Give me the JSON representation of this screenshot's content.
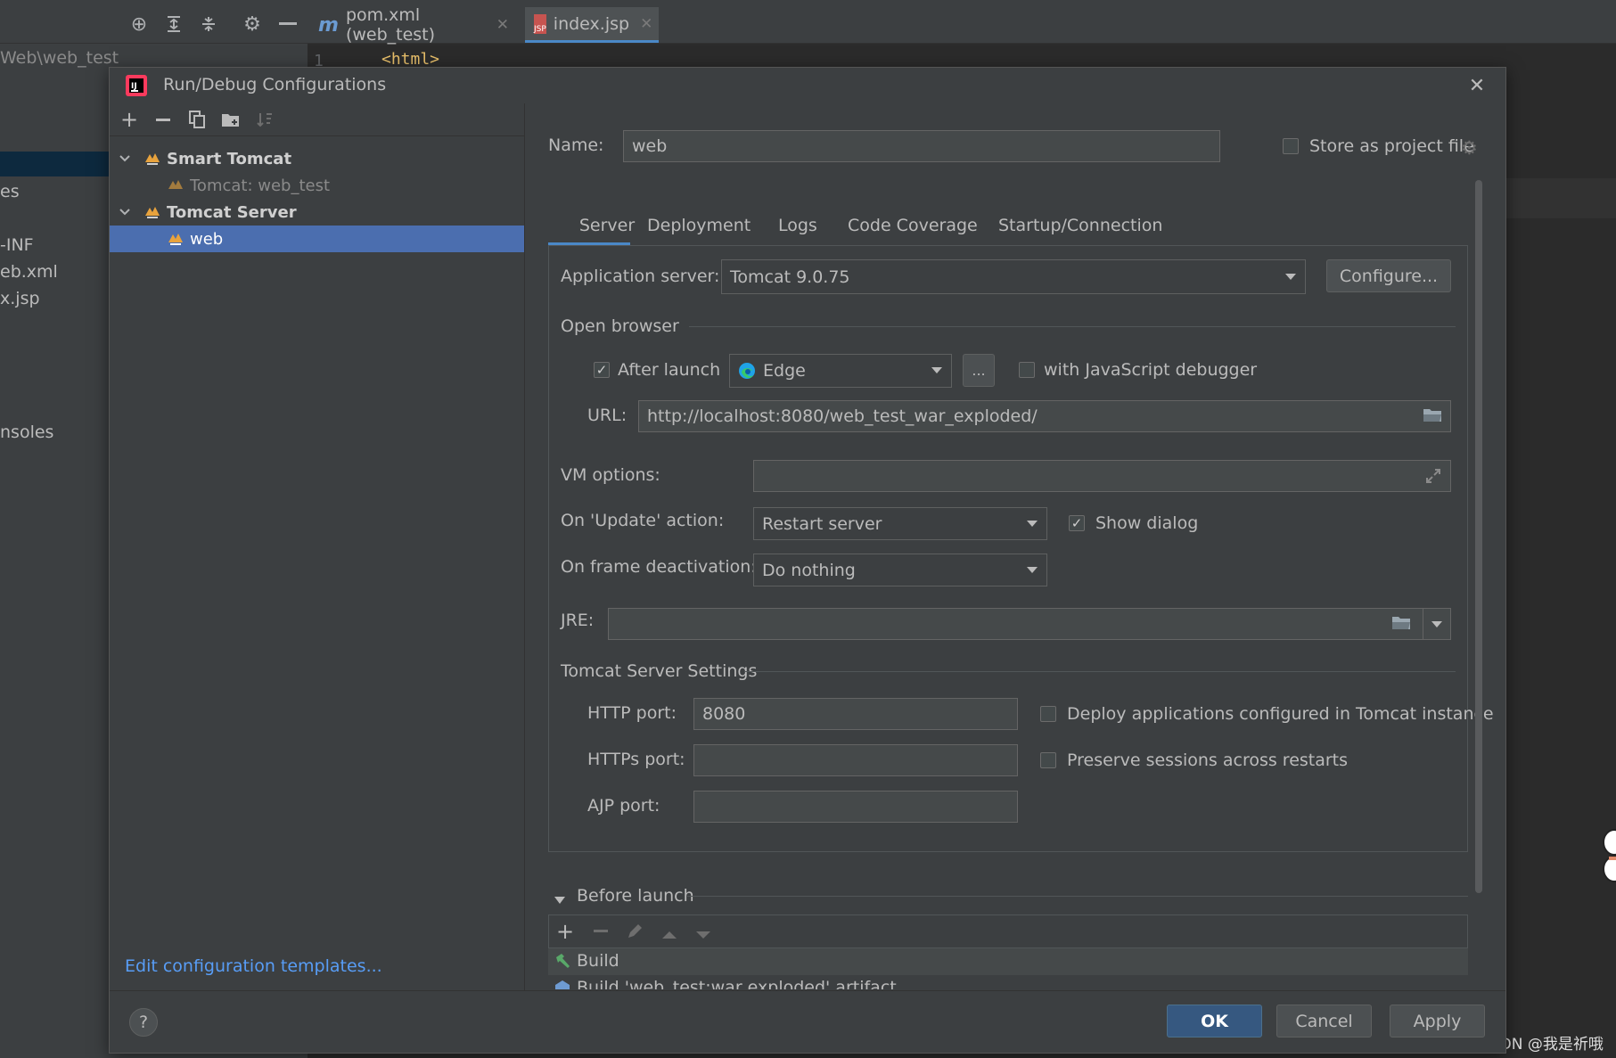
{
  "ide": {
    "tabs": [
      {
        "label": "pom.xml (web_test)",
        "icon": "maven-m-icon"
      },
      {
        "label": "index.jsp",
        "icon": "jsp-file-icon",
        "badge": "JSP"
      }
    ],
    "toolbar_icons": [
      "crosshair-icon",
      "expand-all-icon",
      "collapse-all-icon",
      "gear-icon",
      "minimize-icon"
    ],
    "project_path": "Web\\web_test",
    "tree_fragments": [
      "es",
      "-INF",
      "eb.xml",
      "x.jsp",
      "nsoles"
    ],
    "editor_line_number": "1",
    "editor_line_text": "<html>"
  },
  "dialog": {
    "title": "Run/Debug Configurations",
    "toolbar_icons": [
      "add-icon",
      "remove-icon",
      "copy-icon",
      "new-folder-icon",
      "sort-icon"
    ],
    "tree": [
      {
        "label": "Smart Tomcat",
        "level": 0,
        "expanded": true,
        "bold": true
      },
      {
        "label": "Tomcat: web_test",
        "level": 1,
        "dim": true
      },
      {
        "label": "Tomcat Server",
        "level": 0,
        "expanded": true,
        "bold": true
      },
      {
        "label": "web",
        "level": 1,
        "selected": true
      }
    ],
    "edit_templates_link": "Edit configuration templates...",
    "name_label": "Name:",
    "name_value": "web",
    "store_as_project_file": "Store as project file",
    "tabs": [
      "Server",
      "Deployment",
      "Logs",
      "Code Coverage",
      "Startup/Connection"
    ],
    "active_tab": "Server",
    "server": {
      "app_server_label": "Application server:",
      "app_server_value": "Tomcat 9.0.75",
      "configure_button": "Configure...",
      "open_browser_section": "Open browser",
      "after_launch_label": "After launch",
      "after_launch_checked": true,
      "browser_value": "Edge",
      "browse_button": "...",
      "js_debugger_label": "with JavaScript debugger",
      "js_debugger_checked": false,
      "url_label": "URL:",
      "url_value": "http://localhost:8080/web_test_war_exploded/",
      "vm_options_label": "VM options:",
      "vm_options_value": "",
      "on_update_label": "On 'Update' action:",
      "on_update_value": "Restart server",
      "show_dialog_label": "Show dialog",
      "show_dialog_checked": true,
      "on_frame_label": "On frame deactivation:",
      "on_frame_value": "Do nothing",
      "jre_label": "JRE:",
      "jre_value": "",
      "tomcat_settings_section": "Tomcat Server Settings",
      "http_port_label": "HTTP port:",
      "http_port_value": "8080",
      "https_port_label": "HTTPs port:",
      "https_port_value": "",
      "ajp_port_label": "AJP port:",
      "ajp_port_value": "",
      "deploy_apps_label": "Deploy applications configured in Tomcat instance",
      "preserve_sessions_label": "Preserve sessions across restarts"
    },
    "before_launch": {
      "label": "Before launch",
      "items": [
        "Build",
        "Build 'web_test:war exploded' artifact"
      ]
    },
    "buttons": {
      "ok": "OK",
      "cancel": "Cancel",
      "apply": "Apply",
      "help": "?"
    }
  },
  "watermark": "CSDN @我是祈哦",
  "colors": {
    "accent": "#4a88c7",
    "selection": "#4b6eaf",
    "primary_button": "#365880",
    "link": "#589df6"
  }
}
